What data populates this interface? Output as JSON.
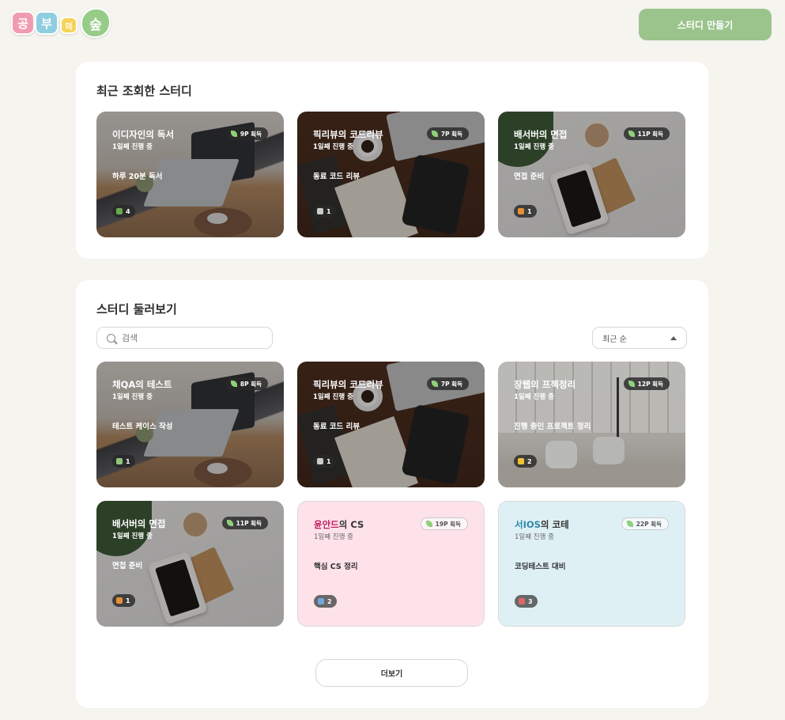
{
  "logo": {
    "c1": "공",
    "c2": "부",
    "c3": "의",
    "c4": "숲"
  },
  "header": {
    "create_label": "스터디 만들기"
  },
  "recent": {
    "title": "최근 조회한 스터디",
    "cards": [
      {
        "title": "이디자인의 독서",
        "day": "1일째 진행 중",
        "desc": "하루 20분 독서",
        "points": "9P 획득",
        "count": "4",
        "scene": "desk",
        "emoji_color": "#6aa84f"
      },
      {
        "title": "픽리뷰의 코드리뷰",
        "day": "1일째 진행 중",
        "desc": "동료 코드 리뷰",
        "points": "7P 획득",
        "count": "1",
        "scene": "coffee",
        "emoji_color": "#cccccc"
      },
      {
        "title": "배서버의 면접",
        "day": "1일째 진행 중",
        "desc": "면접 준비",
        "points": "11P 획득",
        "count": "1",
        "scene": "white",
        "emoji_color": "#e69138"
      }
    ]
  },
  "browse": {
    "title": "스터디 둘러보기",
    "search_placeholder": "검색",
    "sort_label": "최근 순",
    "more_label": "더보기",
    "cards": [
      {
        "title": "채QA의 테스트",
        "day": "1일째 진행 중",
        "desc": "테스트 케이스 작성",
        "points": "8P 획득",
        "count": "1",
        "scene": "desk",
        "emoji_color": "#93c47d"
      },
      {
        "title": "픽리뷰의 코드리뷰",
        "day": "1일째 진행 중",
        "desc": "동료 코드 리뷰",
        "points": "7P 획득",
        "count": "1",
        "scene": "coffee",
        "emoji_color": "#cccccc"
      },
      {
        "title": "장웹의 프젝정리",
        "day": "1일째 진행 중",
        "desc": "진행 중인 프로젝트 정리",
        "points": "12P 획득",
        "count": "2",
        "scene": "office",
        "emoji_color": "#f1c232"
      },
      {
        "title": "배서버의 면접",
        "day": "1일째 진행 중",
        "desc": "면접 준비",
        "points": "11P 획득",
        "count": "1",
        "scene": "white",
        "emoji_color": "#e69138"
      },
      {
        "title_accent": "윤안드",
        "title_rest": "의 CS",
        "accent_color": "#c2185b",
        "day": "1일째 진행 중",
        "desc": "핵심 CS 정리",
        "points": "19P 획득",
        "count": "2",
        "scene": "pink",
        "emoji_color": "#6fa8dc"
      },
      {
        "title_accent": "서IOS",
        "title_rest": "의 코테",
        "accent_color": "#2e8aa8",
        "day": "1일째 진행 중",
        "desc": "코딩테스트 대비",
        "points": "22P 획득",
        "count": "3",
        "scene": "blue",
        "emoji_color": "#e06666"
      }
    ]
  }
}
